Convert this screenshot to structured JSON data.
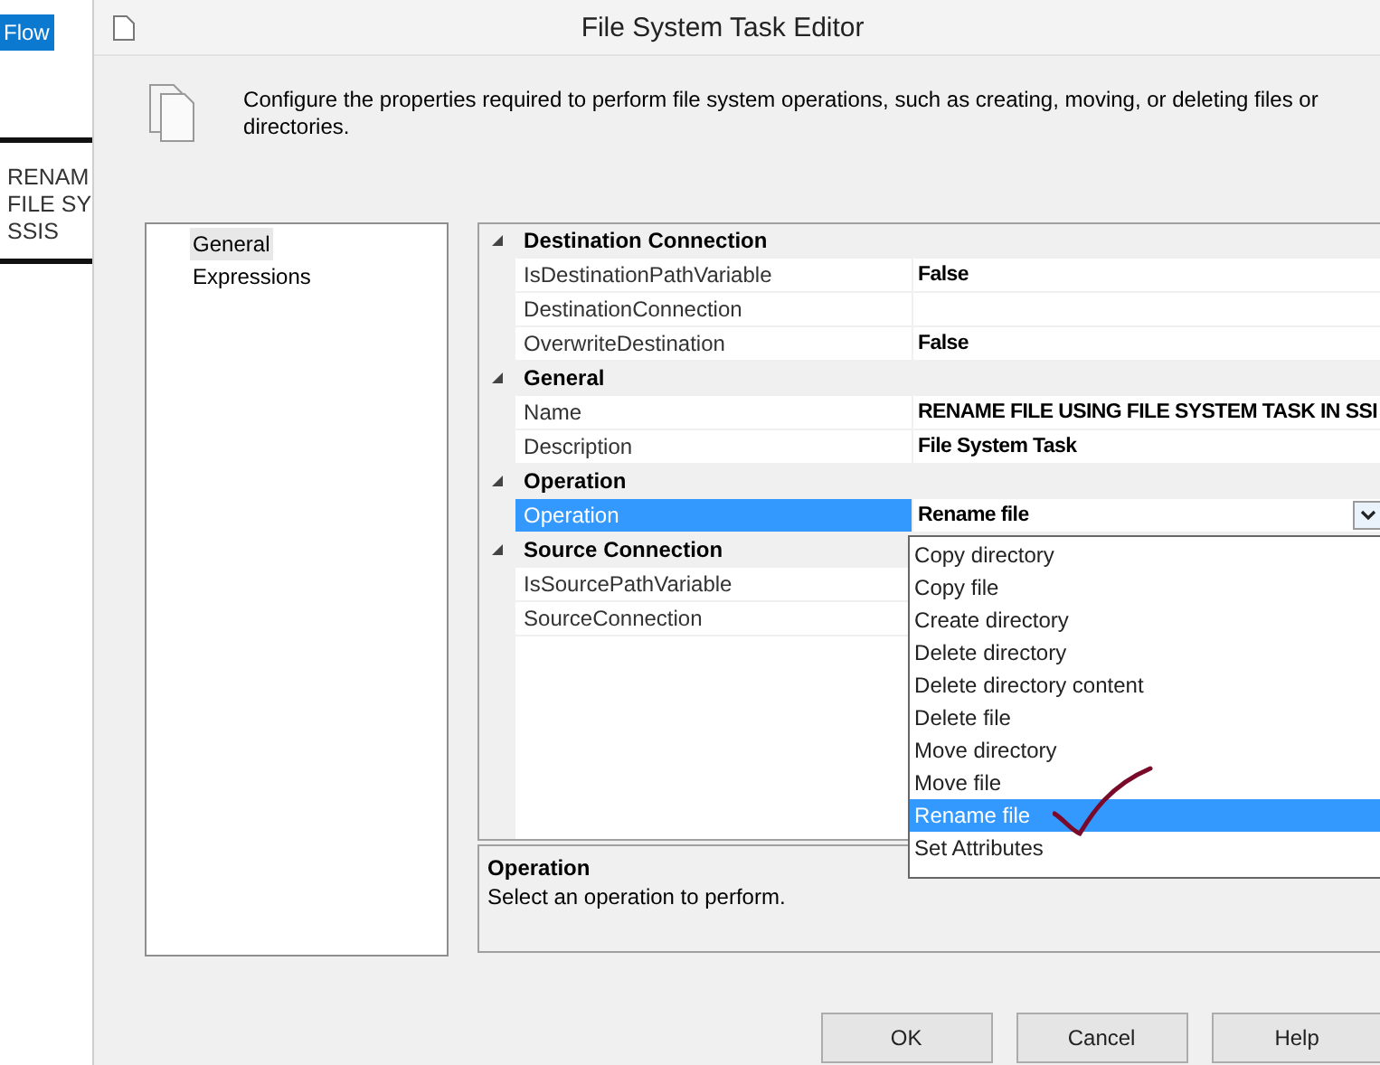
{
  "background_app": {
    "tab": "Flow",
    "item_lines": [
      "RENAM",
      "FILE SY",
      "SSIS"
    ]
  },
  "window": {
    "title": "File System Task Editor"
  },
  "header": {
    "description": "Configure the properties required to perform file system operations, such as creating, moving, or deleting files or directories."
  },
  "nav": {
    "items": [
      {
        "label": "General",
        "selected": true
      },
      {
        "label": "Expressions",
        "selected": false
      }
    ]
  },
  "property_grid": {
    "categories": [
      {
        "name": "Destination Connection",
        "expanded": true,
        "properties": [
          {
            "name": "IsDestinationPathVariable",
            "value": "False",
            "selected": false
          },
          {
            "name": "DestinationConnection",
            "selected": false
          },
          {
            "name": "OverwriteDestination",
            "value": "False",
            "selected": false
          }
        ]
      },
      {
        "name": "General",
        "expanded": true,
        "properties": [
          {
            "name": "Name",
            "value": "RENAME FILE USING FILE SYSTEM TASK IN SSI",
            "selected": false
          },
          {
            "name": "Description",
            "value": "File System Task",
            "selected": false
          }
        ]
      },
      {
        "name": "Operation",
        "expanded": true,
        "properties": [
          {
            "name": "Operation",
            "value": "Rename file",
            "selected": true,
            "kind": "dropdown"
          }
        ]
      },
      {
        "name": "Source Connection",
        "expanded": true,
        "properties": [
          {
            "name": "IsSourcePathVariable",
            "selected": false
          },
          {
            "name": "SourceConnection",
            "selected": false
          }
        ]
      }
    ]
  },
  "dropdown": {
    "items": [
      {
        "label": "Copy directory",
        "selected": false
      },
      {
        "label": "Copy file",
        "selected": false
      },
      {
        "label": "Create directory",
        "selected": false
      },
      {
        "label": "Delete directory",
        "selected": false
      },
      {
        "label": "Delete directory content",
        "selected": false
      },
      {
        "label": "Delete file",
        "selected": false
      },
      {
        "label": "Move directory",
        "selected": false
      },
      {
        "label": "Move file",
        "selected": false
      },
      {
        "label": "Rename file",
        "selected": true
      },
      {
        "label": "Set Attributes",
        "selected": false
      }
    ]
  },
  "description_panel": {
    "title": "Operation",
    "text": "Select an operation to perform."
  },
  "buttons": [
    "OK",
    "Cancel",
    "Help"
  ]
}
